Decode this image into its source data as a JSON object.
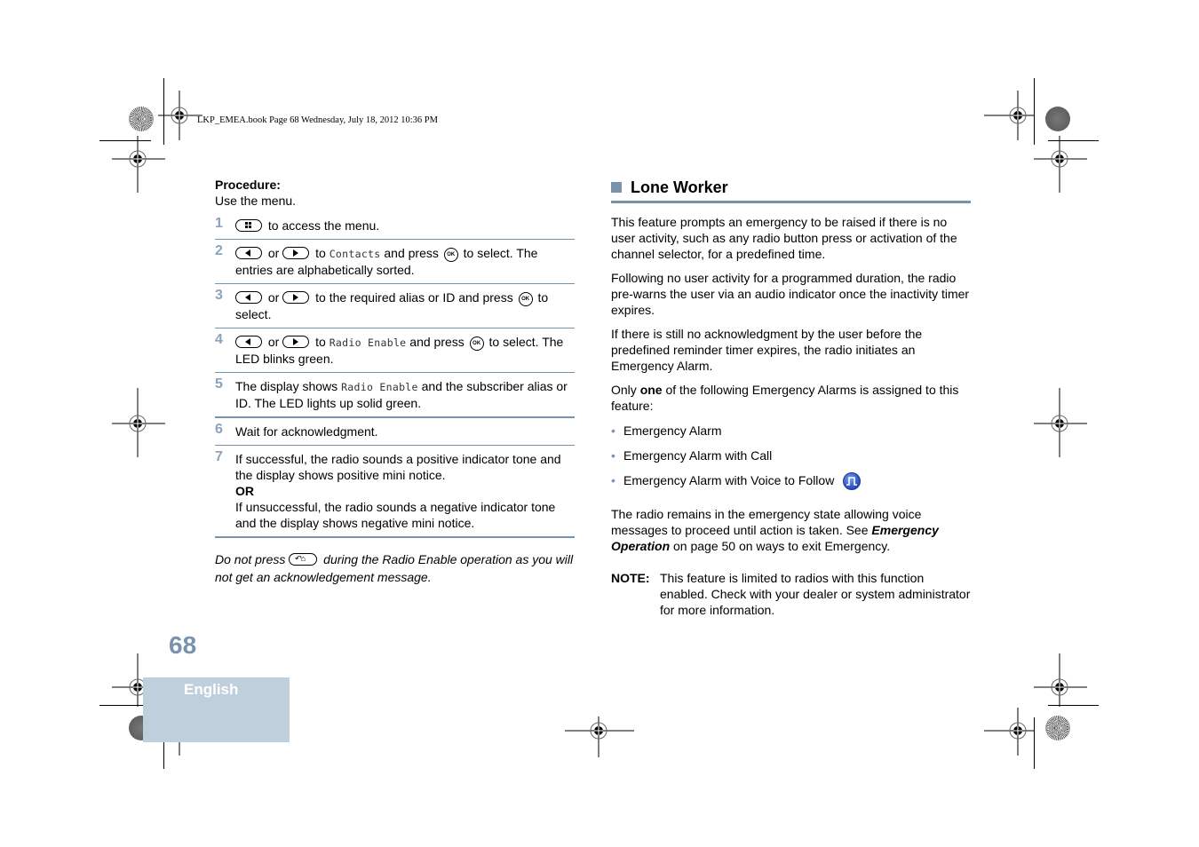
{
  "print_header": "LKP_EMEA.book  Page 68  Wednesday, July 18, 2012  10:36 PM",
  "procedure": {
    "title": "Procedure:",
    "intro": "Use the menu.",
    "steps": [
      {
        "num": "1",
        "parts": {
          "a": "to access the menu."
        }
      },
      {
        "num": "2",
        "parts": {
          "or": "or",
          "to": "to",
          "mono": "Contacts",
          "press": "and press",
          "rest": "to select. The entries are alphabetically sorted."
        }
      },
      {
        "num": "3",
        "parts": {
          "or": "or",
          "rest_before_ok": "to the required alias or ID and press",
          "rest": "to select."
        }
      },
      {
        "num": "4",
        "parts": {
          "or": "or",
          "to": "to",
          "mono": "Radio Enable",
          "press": "and press",
          "rest": "to select. The LED blinks green."
        }
      },
      {
        "num": "5",
        "parts": {
          "a": "The display shows",
          "mono": "Radio Enable",
          "rest": "and the subscriber alias or ID. The LED lights up solid green."
        }
      },
      {
        "num": "6",
        "parts": {
          "a": "Wait for acknowledgment."
        }
      },
      {
        "num": "7",
        "parts": {
          "a": "If successful, the radio sounds a positive indicator tone and the display shows positive mini notice.",
          "or": "OR",
          "b": "If unsuccessful, the radio sounds a negative indicator tone and the display shows negative mini notice."
        }
      }
    ],
    "keys": {
      "ok_label": "OK",
      "menu_key": "menu-key-icon",
      "left_key": "left-arrow-key-icon",
      "right_key": "right-arrow-key-icon",
      "back_home_key": "back-home-key-icon"
    },
    "note": {
      "before": "Do not press",
      "after": "during the Radio Enable operation as you will not get an acknowledgement message."
    }
  },
  "section": {
    "title": "Lone Worker",
    "paragraphs": [
      "This feature prompts an emergency to be raised if there is no user activity, such as any radio button press or activation of the channel selector, for a predefined time.",
      "Following no user activity for a programmed duration, the radio pre-warns the user via an audio indicator once the inactivity timer expires.",
      "If there is still no acknowledgment by the user before the predefined reminder timer expires, the radio initiates an Emergency Alarm."
    ],
    "only_one": {
      "before": "Only",
      "bold": "one",
      "after": "of the following Emergency Alarms is assigned to this feature:"
    },
    "bullets": [
      "Emergency Alarm",
      "Emergency Alarm with Call",
      "Emergency Alarm with Voice to Follow"
    ],
    "bullet_icon": "pulse-wave-icon",
    "remains": {
      "before": "The radio remains in the emergency state allowing voice messages to proceed until action is taken. See",
      "link": "Emergency Operation",
      "after": "on page 50 on ways to exit Emergency."
    },
    "note": {
      "label": "NOTE:",
      "text": "This feature is limited to radios with this function enabled. Check with your dealer or system administrator for more information."
    }
  },
  "footer": {
    "page_number": "68",
    "language": "English"
  },
  "colors": {
    "accent": "#7a93ad",
    "tab_bg": "#c0cfdc"
  }
}
